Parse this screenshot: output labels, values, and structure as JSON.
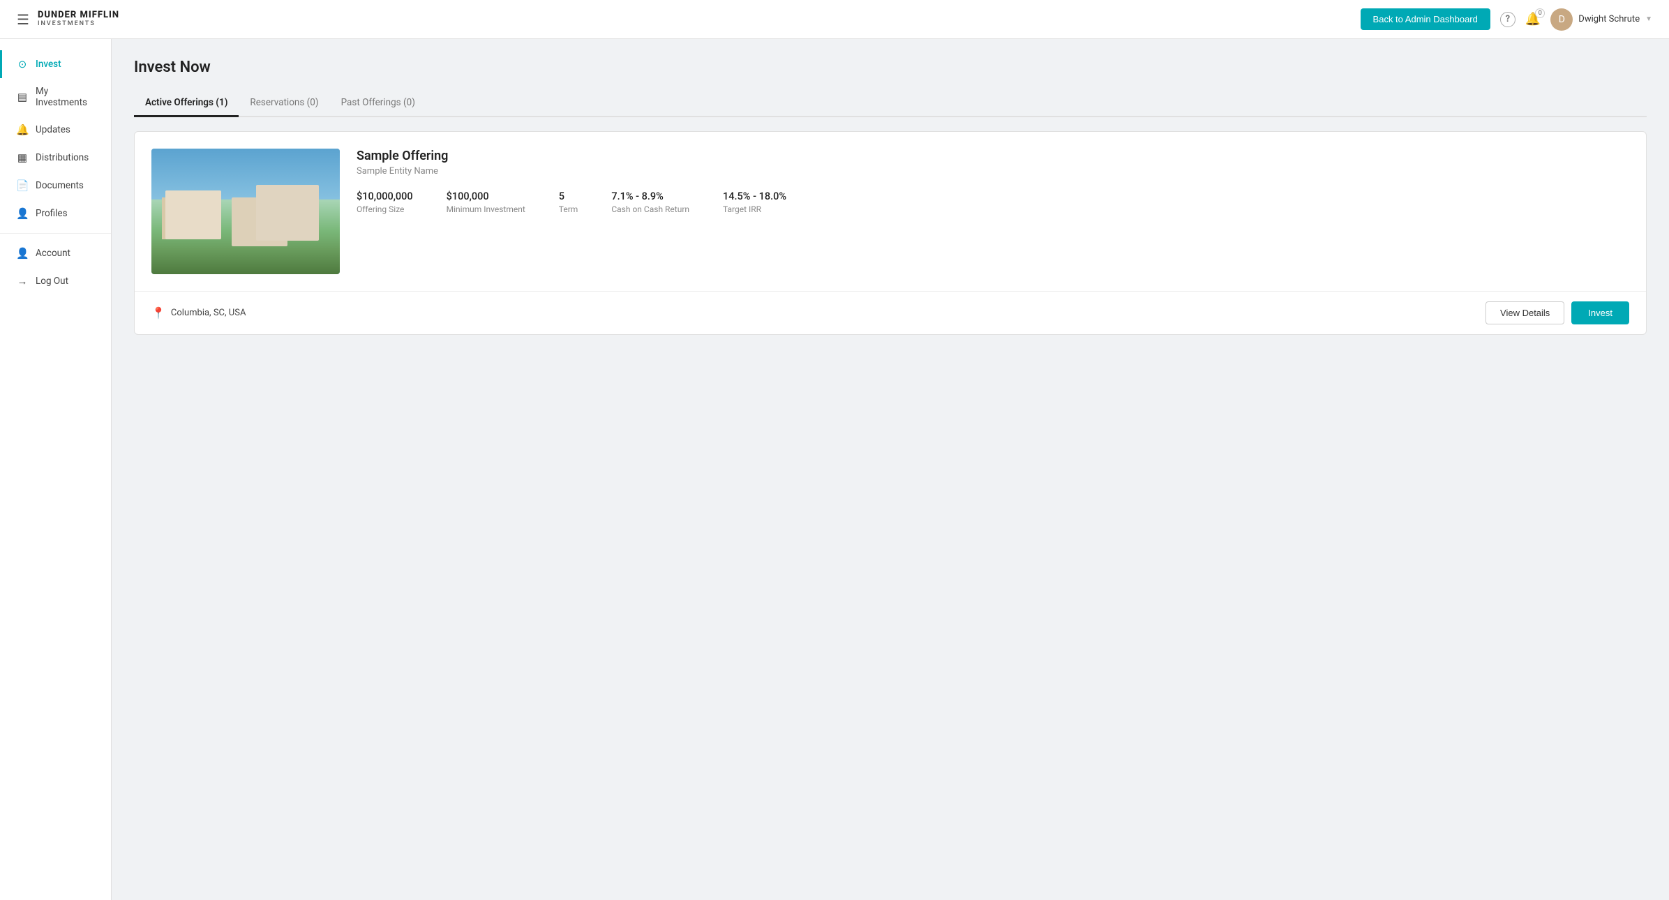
{
  "header": {
    "logo_title": "DUNDER MIFFLIN",
    "logo_subtitle": "INVESTMENTS",
    "back_button_label": "Back to Admin Dashboard",
    "notification_count": "0",
    "user_name": "Dwight Schrute"
  },
  "sidebar": {
    "items": [
      {
        "id": "invest",
        "label": "Invest",
        "icon": "●",
        "active": true
      },
      {
        "id": "my-investments",
        "label": "My Investments",
        "icon": "▤",
        "active": false
      },
      {
        "id": "updates",
        "label": "Updates",
        "icon": "🔔",
        "active": false
      },
      {
        "id": "distributions",
        "label": "Distributions",
        "icon": "▦",
        "active": false
      },
      {
        "id": "documents",
        "label": "Documents",
        "icon": "📄",
        "active": false
      },
      {
        "id": "profiles",
        "label": "Profiles",
        "icon": "👤",
        "active": false
      }
    ],
    "bottom_items": [
      {
        "id": "account",
        "label": "Account",
        "icon": "👤"
      },
      {
        "id": "logout",
        "label": "Log Out",
        "icon": "→"
      }
    ]
  },
  "main": {
    "page_title": "Invest Now",
    "tabs": [
      {
        "id": "active",
        "label": "Active Offerings (1)",
        "active": true
      },
      {
        "id": "reservations",
        "label": "Reservations (0)",
        "active": false
      },
      {
        "id": "past",
        "label": "Past Offerings (0)",
        "active": false
      }
    ],
    "offering": {
      "title": "Sample Offering",
      "entity": "Sample Entity Name",
      "stats": [
        {
          "value": "$10,000,000",
          "label": "Offering Size"
        },
        {
          "value": "$100,000",
          "label": "Minimum Investment"
        },
        {
          "value": "5",
          "label": "Term"
        },
        {
          "value": "7.1% - 8.9%",
          "label": "Cash on Cash Return"
        },
        {
          "value": "14.5% - 18.0%",
          "label": "Target IRR"
        }
      ],
      "location": "Columbia, SC, USA",
      "view_details_label": "View Details",
      "invest_label": "Invest"
    }
  }
}
